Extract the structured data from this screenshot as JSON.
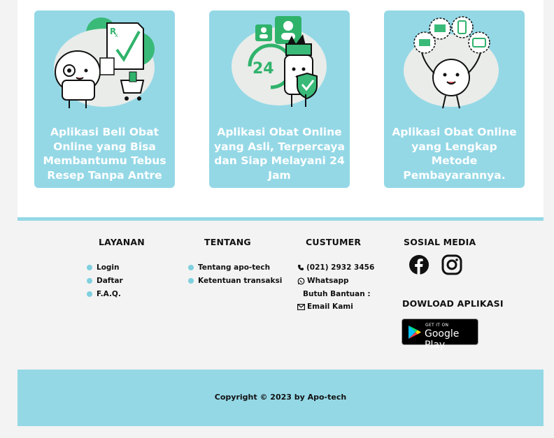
{
  "cards": [
    {
      "caption": "Aplikasi Beli Obat Online yang Bisa Membantumu Tebus Resep Tanpa Antre"
    },
    {
      "caption": "Aplikasi Obat Online yang Asli, Terpercaya dan Siap Melayani 24 Jam",
      "badge": "24"
    },
    {
      "caption": "Aplikasi Obat Online yang Lengkap Metode Pembayarannya."
    }
  ],
  "footer": {
    "layanan": {
      "title": "LAYANAN",
      "links": [
        "Login",
        "Daftar",
        "F.A.Q."
      ]
    },
    "tentang": {
      "title": "TENTANG",
      "links": [
        "Tentang apo-tech",
        "Ketentuan transaksi"
      ]
    },
    "customer": {
      "title": "CUSTUMER",
      "phone": "(021) 2932 3456",
      "whatsapp": "Whatsapp",
      "help": "Butuh Bantuan :",
      "email": "Email Kami"
    },
    "social": {
      "title": "SOSIAL MEDIA",
      "icons": [
        "facebook-icon",
        "instagram-icon"
      ]
    },
    "app": {
      "title": "DOWLOAD APLIKASI",
      "badge_small": "GET IT ON",
      "badge_big": "Google Play"
    },
    "copyright": "Copyright © 2023 by Apo-tech"
  },
  "colors": {
    "accent": "#94d8e6",
    "green": "#2fb36b",
    "background": "#f3f3f3"
  }
}
